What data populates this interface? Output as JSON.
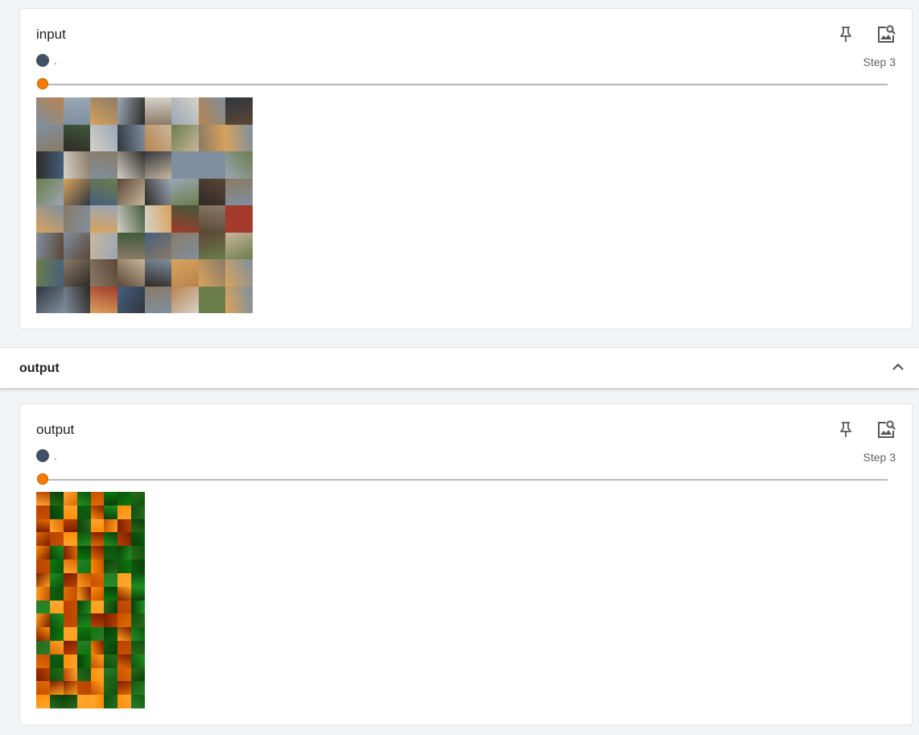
{
  "input_card": {
    "title": "input",
    "run_name": ".",
    "step_label": "Step 3",
    "pin_icon": "pin-icon",
    "expand_icon": "image-search-icon",
    "run_color": "#425066",
    "slider_value": 0
  },
  "output_section": {
    "title": "output",
    "toggle_icon": "chevron-up-icon"
  },
  "output_card": {
    "title": "output",
    "run_name": ".",
    "step_label": "Step 3",
    "pin_icon": "pin-icon",
    "expand_icon": "image-search-icon",
    "run_color": "#425066",
    "slider_value": 0
  },
  "colors": {
    "accent": "#f57c00",
    "background": "#f3f4f6",
    "card": "#ffffff",
    "run": "#425066"
  }
}
